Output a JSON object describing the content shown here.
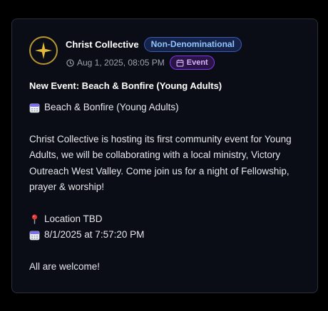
{
  "post": {
    "org_name": "Christ Collective",
    "denomination": "Non-Denominational",
    "timestamp": "Aug 1, 2025, 08:05 PM",
    "type_label": "Event",
    "title": "New Event: Beach & Bonfire (Young Adults)",
    "event_line": "Beach & Bonfire (Young Adults)",
    "description": "Christ Collective is hosting its first community event for Young Adults, we will be collaborating with a local ministry, Victory Outreach West Valley. Come join us for a night of Fellowship, prayer & worship!",
    "location": "Location TBD",
    "datetime": "8/1/2025 at 7:57:20 PM",
    "closing": "All are welcome!"
  },
  "icons": {
    "avatar": "gold-star-logo",
    "time": "clock-icon",
    "event": "calendar-icon",
    "calendar_emoji": "calendar-emoji-icon",
    "pin_emoji": "pin-emoji-icon"
  },
  "colors": {
    "card_bg": "#0b0d16",
    "denom_pill": "#93c5fd",
    "event_pill": "#d8b4fe",
    "logo_gold": "#d4af37"
  }
}
